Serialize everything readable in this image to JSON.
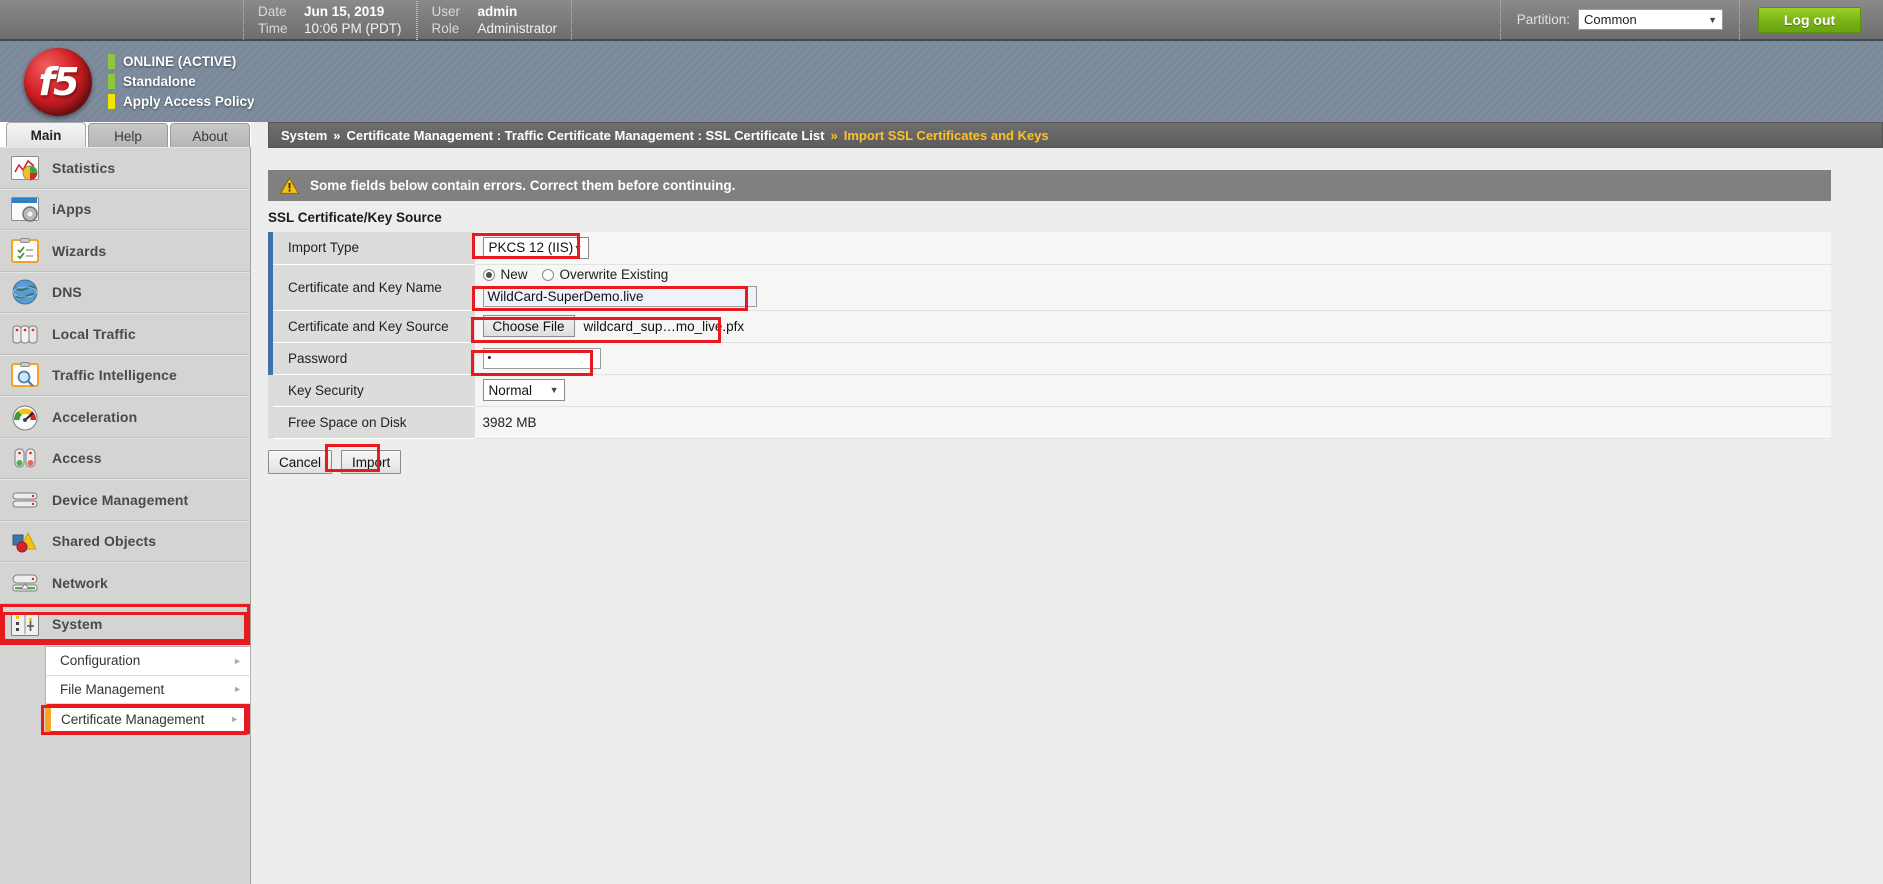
{
  "topbar": {
    "date_label": "Date",
    "date_value": "Jun 15, 2019",
    "time_label": "Time",
    "time_value": "10:06 PM (PDT)",
    "user_label": "User",
    "user_value": "admin",
    "role_label": "Role",
    "role_value": "Administrator",
    "partition_label": "Partition:",
    "partition_value": "Common",
    "logout_label": "Log out"
  },
  "banner": {
    "logo_text": "f5",
    "statuses": [
      {
        "text": "ONLINE (ACTIVE)",
        "color": "#8dc63f"
      },
      {
        "text": "Standalone",
        "color": "#8dc63f"
      },
      {
        "text": "Apply Access Policy",
        "color": "#f2e500"
      }
    ]
  },
  "tabs": [
    {
      "label": "Main",
      "active": true
    },
    {
      "label": "Help",
      "active": false
    },
    {
      "label": "About",
      "active": false
    }
  ],
  "sidebar": {
    "items": [
      {
        "label": "Statistics",
        "icon": "statistics-icon",
        "selected": false
      },
      {
        "label": "iApps",
        "icon": "iapps-icon",
        "selected": false
      },
      {
        "label": "Wizards",
        "icon": "wizards-icon",
        "selected": false
      },
      {
        "label": "DNS",
        "icon": "dns-globe-icon",
        "selected": false
      },
      {
        "label": "Local Traffic",
        "icon": "local-traffic-icon",
        "selected": false
      },
      {
        "label": "Traffic Intelligence",
        "icon": "traffic-intelligence-icon",
        "selected": false
      },
      {
        "label": "Acceleration",
        "icon": "acceleration-gauge-icon",
        "selected": false
      },
      {
        "label": "Access",
        "icon": "access-icon",
        "selected": false
      },
      {
        "label": "Device Management",
        "icon": "device-management-icon",
        "selected": false
      },
      {
        "label": "Shared Objects",
        "icon": "shared-objects-icon",
        "selected": false
      },
      {
        "label": "Network",
        "icon": "network-icon",
        "selected": false
      },
      {
        "label": "System",
        "icon": "system-icon",
        "selected": true
      }
    ],
    "submenu": [
      {
        "label": "Configuration",
        "selected": false
      },
      {
        "label": "File Management",
        "selected": false
      },
      {
        "label": "Certificate Management",
        "selected": true
      }
    ]
  },
  "breadcrumb": {
    "root": "System",
    "sep1": "»",
    "path": "Certificate Management : Traffic Certificate Management : SSL Certificate List",
    "sep2": "»",
    "current": "Import SSL Certificates and Keys"
  },
  "error_banner": {
    "icon": "warning-triangle-icon",
    "text": "Some fields below contain errors. Correct them before continuing."
  },
  "form": {
    "section_title": "SSL Certificate/Key Source",
    "import_type": {
      "label": "Import Type",
      "value": "PKCS 12 (IIS)"
    },
    "cert_key_name": {
      "label": "Certificate and Key Name",
      "radio_new": "New",
      "radio_overwrite": "Overwrite Existing",
      "selected_radio": "New",
      "value": "WildCard-SuperDemo.live"
    },
    "cert_key_source": {
      "label": "Certificate and Key Source",
      "choose_button": "Choose File",
      "filename": "wildcard_sup…mo_live.pfx"
    },
    "password": {
      "label": "Password",
      "value": "•"
    },
    "key_security": {
      "label": "Key Security",
      "value": "Normal"
    },
    "free_space": {
      "label": "Free Space on Disk",
      "value": "3982 MB"
    },
    "buttons": {
      "cancel": "Cancel",
      "import": "Import"
    }
  },
  "colors": {
    "annotation": "#e8191f",
    "accent_blue": "#3f74a8",
    "crumb_current": "#ffc125",
    "logout_green": "#7cb518"
  }
}
